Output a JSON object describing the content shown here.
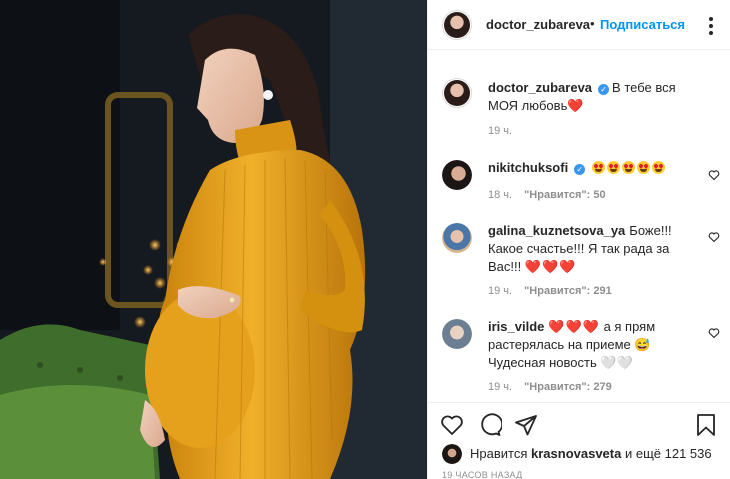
{
  "post": {
    "author": "doctor_zubareva",
    "separator": "•",
    "follow_label": "Подписаться",
    "caption": "В тебе вся МОЯ любовь",
    "caption_time": "19 ч."
  },
  "comments": [
    {
      "user": "nikitchuksofi",
      "verified": true,
      "text": "",
      "emoji": "face-with-heart-eyes x5",
      "time": "18 ч.",
      "likes": "\"Нравится\": 50"
    },
    {
      "user": "galina_kuznetsova_ya",
      "text": "Боже!!! Какое счастье!!! Я так рада за Вас!!!",
      "emoji": "red-heart x3",
      "time": "19 ч.",
      "likes": "\"Нравится\": 291"
    },
    {
      "user": "iris_vilde",
      "text_before": "а я прям растерялась на приеме",
      "text_after": "Чудесная новость",
      "emoji": "red-heart x3, sweat-smile, white-heart x2",
      "time": "19 ч.",
      "likes": "\"Нравится\": 279"
    }
  ],
  "likes_line": {
    "prefix": "Нравится",
    "user": "krasnovasveta",
    "suffix": "и ещё 121 536"
  },
  "timestamp": "19 ЧАСОВ НАЗАД",
  "icons": {
    "post_actions": [
      "heart-icon",
      "comment-icon",
      "share-icon",
      "bookmark-icon"
    ],
    "more": "more-options-icon"
  },
  "colors": {
    "link_blue": "#0095f6",
    "text": "#262626",
    "secondary": "#8e8e8e",
    "dress_yellow": "#e9a21a",
    "verified_blue": "#3897f0"
  }
}
